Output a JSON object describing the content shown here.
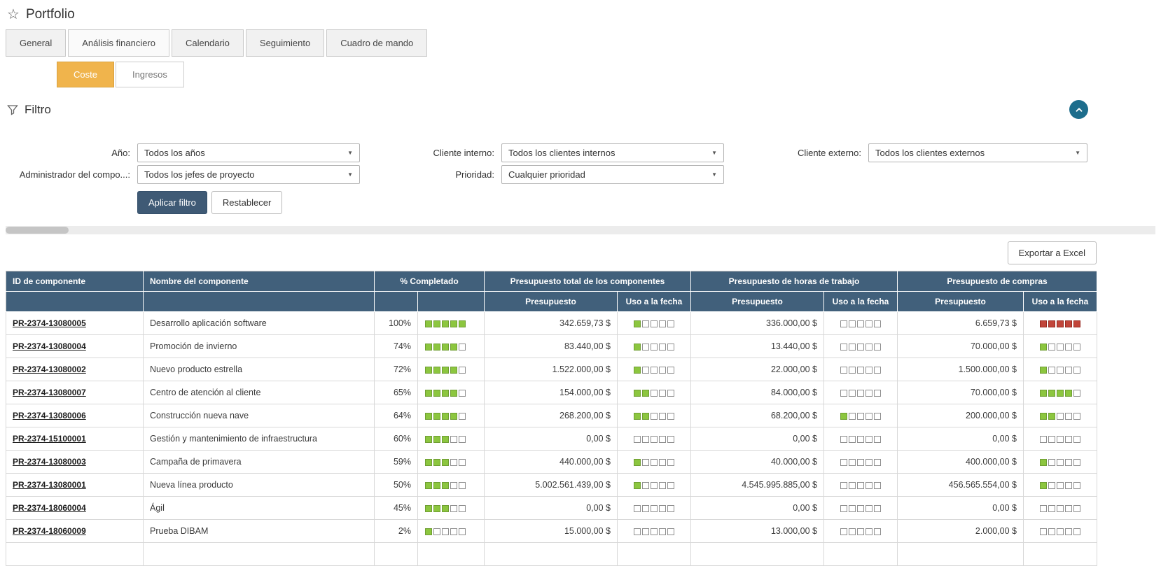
{
  "page": {
    "title": "Portfolio"
  },
  "icons": {
    "star": "☆",
    "select_arrow": "▼",
    "funnel": "funnel-outline",
    "collapse": "chevron-up"
  },
  "tabs": [
    {
      "label": "General",
      "active": false
    },
    {
      "label": "Análisis financiero",
      "active": true
    },
    {
      "label": "Calendario",
      "active": false
    },
    {
      "label": "Seguimiento",
      "active": false
    },
    {
      "label": "Cuadro de mando",
      "active": false
    }
  ],
  "subtabs": [
    {
      "label": "Coste",
      "active": true
    },
    {
      "label": "Ingresos",
      "active": false
    }
  ],
  "filter": {
    "title": "Filtro",
    "rows": [
      [
        {
          "name": "año",
          "label": "Año:",
          "value": "Todos los años"
        },
        {
          "name": "cliente interno",
          "label": "Cliente interno:",
          "value": "Todos los clientes internos"
        },
        {
          "name": "cliente externo",
          "label": "Cliente externo:",
          "value": "Todos los clientes externos"
        }
      ],
      [
        {
          "name": "administrador del componente",
          "label": "Administrador del compo...:",
          "value": "Todos los jefes de proyecto"
        },
        {
          "name": "prioridad",
          "label": "Prioridad:",
          "value": "Cualquier prioridad"
        }
      ]
    ],
    "apply_label": "Aplicar filtro",
    "reset_label": "Restablecer"
  },
  "toolbar": {
    "export_label": "Exportar a Excel"
  },
  "table": {
    "group_headers": [
      {
        "label": "ID de componente",
        "span": 1,
        "align": "left"
      },
      {
        "label": "Nombre del componente",
        "span": 1,
        "align": "left"
      },
      {
        "label": "% Completado",
        "span": 2,
        "align": "center"
      },
      {
        "label": "Presupuesto total de los componentes",
        "span": 2,
        "align": "center"
      },
      {
        "label": "Presupuesto de horas de trabajo",
        "span": 2,
        "align": "center"
      },
      {
        "label": "Presupuesto de compras",
        "span": 2,
        "align": "center"
      }
    ],
    "sub_headers": [
      "",
      "",
      "",
      "",
      "Presupuesto",
      "Uso a la fecha",
      "Presupuesto",
      "Uso a la fecha",
      "Presupuesto",
      "Uso a la fecha"
    ],
    "rows": [
      {
        "id": "PR-2374-13080005",
        "name": "Desarrollo aplicación software",
        "pct": "100%",
        "pct_filled": 5,
        "total": {
          "budget": "342.659,73 $",
          "used": 1,
          "used_color": "green"
        },
        "hours": {
          "budget": "336.000,00 $",
          "used": 0,
          "used_color": "green"
        },
        "purchases": {
          "budget": "6.659,73 $",
          "used": 5,
          "used_color": "red"
        }
      },
      {
        "id": "PR-2374-13080004",
        "name": "Promoción de invierno",
        "pct": "74%",
        "pct_filled": 4,
        "total": {
          "budget": "83.440,00 $",
          "used": 1,
          "used_color": "green"
        },
        "hours": {
          "budget": "13.440,00 $",
          "used": 0,
          "used_color": "green"
        },
        "purchases": {
          "budget": "70.000,00 $",
          "used": 1,
          "used_color": "green"
        }
      },
      {
        "id": "PR-2374-13080002",
        "name": "Nuevo producto estrella",
        "pct": "72%",
        "pct_filled": 4,
        "total": {
          "budget": "1.522.000,00 $",
          "used": 1,
          "used_color": "green"
        },
        "hours": {
          "budget": "22.000,00 $",
          "used": 0,
          "used_color": "green"
        },
        "purchases": {
          "budget": "1.500.000,00 $",
          "used": 1,
          "used_color": "green"
        }
      },
      {
        "id": "PR-2374-13080007",
        "name": "Centro de atención al cliente",
        "pct": "65%",
        "pct_filled": 4,
        "total": {
          "budget": "154.000,00 $",
          "used": 2,
          "used_color": "green"
        },
        "hours": {
          "budget": "84.000,00 $",
          "used": 0,
          "used_color": "green"
        },
        "purchases": {
          "budget": "70.000,00 $",
          "used": 4,
          "used_color": "green"
        }
      },
      {
        "id": "PR-2374-13080006",
        "name": "Construcción nueva nave",
        "pct": "64%",
        "pct_filled": 4,
        "total": {
          "budget": "268.200,00 $",
          "used": 2,
          "used_color": "green"
        },
        "hours": {
          "budget": "68.200,00 $",
          "used": 1,
          "used_color": "green"
        },
        "purchases": {
          "budget": "200.000,00 $",
          "used": 2,
          "used_color": "green"
        }
      },
      {
        "id": "PR-2374-15100001",
        "name": "Gestión y mantenimiento de infraestructura",
        "pct": "60%",
        "pct_filled": 3,
        "total": {
          "budget": "0,00 $",
          "used": 0,
          "used_color": "green"
        },
        "hours": {
          "budget": "0,00 $",
          "used": 0,
          "used_color": "green"
        },
        "purchases": {
          "budget": "0,00 $",
          "used": 0,
          "used_color": "green"
        }
      },
      {
        "id": "PR-2374-13080003",
        "name": "Campaña de primavera",
        "pct": "59%",
        "pct_filled": 3,
        "total": {
          "budget": "440.000,00 $",
          "used": 1,
          "used_color": "green"
        },
        "hours": {
          "budget": "40.000,00 $",
          "used": 0,
          "used_color": "green"
        },
        "purchases": {
          "budget": "400.000,00 $",
          "used": 1,
          "used_color": "green"
        }
      },
      {
        "id": "PR-2374-13080001",
        "name": "Nueva línea producto",
        "pct": "50%",
        "pct_filled": 3,
        "total": {
          "budget": "5.002.561.439,00 $",
          "used": 1,
          "used_color": "green"
        },
        "hours": {
          "budget": "4.545.995.885,00 $",
          "used": 0,
          "used_color": "green"
        },
        "purchases": {
          "budget": "456.565.554,00 $",
          "used": 1,
          "used_color": "green"
        }
      },
      {
        "id": "PR-2374-18060004",
        "name": "Ágil",
        "pct": "45%",
        "pct_filled": 3,
        "total": {
          "budget": "0,00 $",
          "used": 0,
          "used_color": "green"
        },
        "hours": {
          "budget": "0,00 $",
          "used": 0,
          "used_color": "green"
        },
        "purchases": {
          "budget": "0,00 $",
          "used": 0,
          "used_color": "green"
        }
      },
      {
        "id": "PR-2374-18060009",
        "name": "Prueba DIBAM",
        "pct": "2%",
        "pct_filled": 1,
        "total": {
          "budget": "15.000,00 $",
          "used": 0,
          "used_color": "green"
        },
        "hours": {
          "budget": "13.000,00 $",
          "used": 0,
          "used_color": "green"
        },
        "purchases": {
          "budget": "2.000,00 $",
          "used": 0,
          "used_color": "green"
        }
      }
    ]
  },
  "colors": {
    "table_header": "#41607b",
    "progress_green": "#8cc63f",
    "over_budget_red": "#c1453a",
    "active_subtab": "#f0b44c",
    "primary_button": "#3f5a75",
    "collapse_button": "#1d6d8c"
  }
}
